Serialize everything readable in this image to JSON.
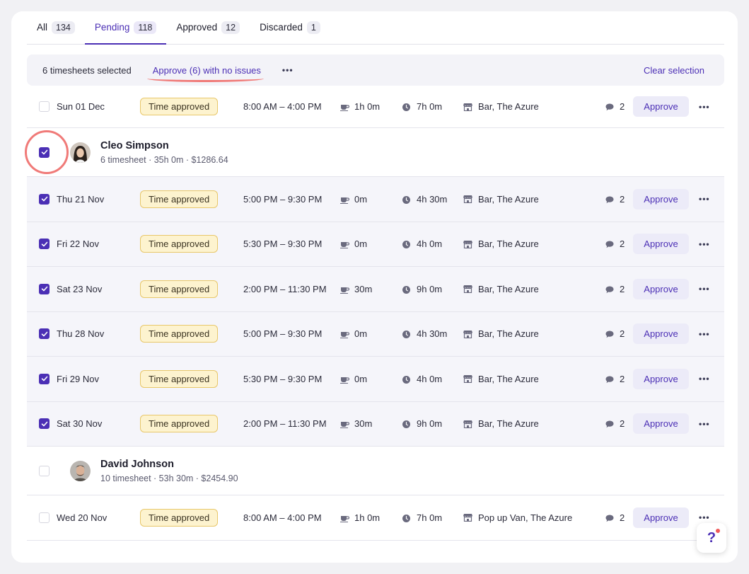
{
  "tabs": [
    {
      "label": "All",
      "count": "134"
    },
    {
      "label": "Pending",
      "count": "118"
    },
    {
      "label": "Approved",
      "count": "12"
    },
    {
      "label": "Discarded",
      "count": "1"
    }
  ],
  "selection_bar": {
    "selected_text": "6 timesheets selected",
    "approve_label": "Approve (6) with no issues",
    "more_label": "•••",
    "clear_label": "Clear selection"
  },
  "common": {
    "status": "Time approved",
    "approve_label": "Approve",
    "more_label": "•••"
  },
  "first_row": {
    "date": "Sun 01 Dec",
    "time": "8:00 AM – 4:00 PM",
    "break": "1h 0m",
    "duration": "7h 0m",
    "location": "Bar, The Azure",
    "comments": "2"
  },
  "people": [
    {
      "name": "Cleo Simpson",
      "meta": "6 timesheet · 35h 0m · $1286.64",
      "rows": [
        {
          "date": "Thu 21 Nov",
          "time": "5:00 PM – 9:30 PM",
          "break": "0m",
          "duration": "4h 30m",
          "location": "Bar, The Azure",
          "comments": "2"
        },
        {
          "date": "Fri 22 Nov",
          "time": "5:30 PM – 9:30 PM",
          "break": "0m",
          "duration": "4h 0m",
          "location": "Bar, The Azure",
          "comments": "2"
        },
        {
          "date": "Sat 23 Nov",
          "time": "2:00 PM – 11:30 PM",
          "break": "30m",
          "duration": "9h 0m",
          "location": "Bar, The Azure",
          "comments": "2"
        },
        {
          "date": "Thu 28 Nov",
          "time": "5:00 PM – 9:30 PM",
          "break": "0m",
          "duration": "4h 30m",
          "location": "Bar, The Azure",
          "comments": "2"
        },
        {
          "date": "Fri 29 Nov",
          "time": "5:30 PM – 9:30 PM",
          "break": "0m",
          "duration": "4h 0m",
          "location": "Bar, The Azure",
          "comments": "2"
        },
        {
          "date": "Sat 30 Nov",
          "time": "2:00 PM – 11:30 PM",
          "break": "30m",
          "duration": "9h 0m",
          "location": "Bar, The Azure",
          "comments": "2"
        }
      ]
    },
    {
      "name": "David Johnson",
      "meta": "10 timesheet · 53h 30m · $2454.90",
      "rows": [
        {
          "date": "Wed 20 Nov",
          "time": "8:00 AM – 4:00 PM",
          "break": "1h 0m",
          "duration": "7h 0m",
          "location": "Pop up Van, The Azure",
          "comments": "2"
        }
      ]
    }
  ],
  "help": {
    "label": "?"
  },
  "colors": {
    "accent": "#4b2fb5",
    "badge_bg": "#fdf3cf",
    "badge_border": "#e8c76a",
    "annotation": "#f07a78"
  }
}
